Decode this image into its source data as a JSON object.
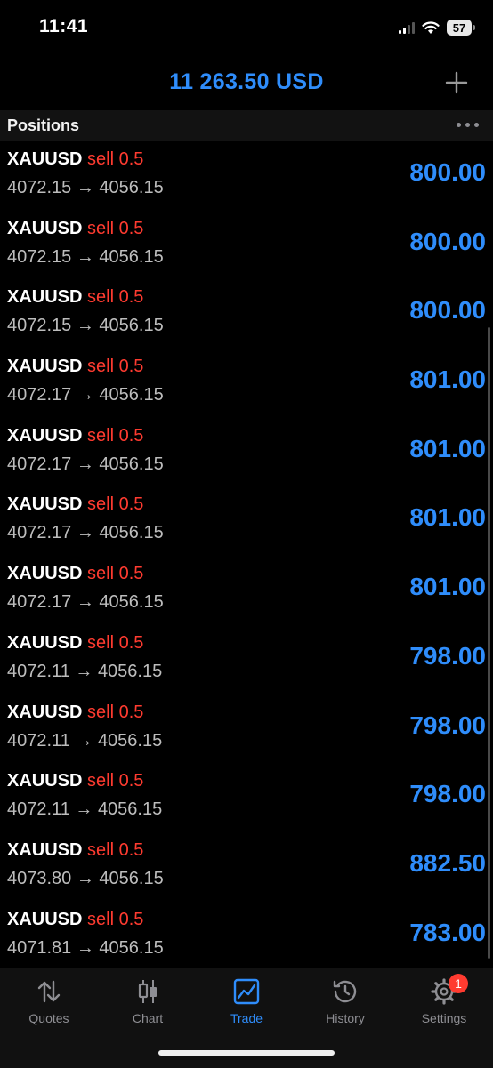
{
  "status_bar": {
    "time": "11:41",
    "battery": "57"
  },
  "header": {
    "balance": "11 263.50 USD",
    "add_icon": "plus-icon"
  },
  "section": {
    "title": "Positions",
    "more_icon": "more-horizontal-icon"
  },
  "positions": [
    {
      "symbol": "XAUUSD",
      "side": "sell",
      "volume": "0.5",
      "open": "4072.15",
      "arrow": "→",
      "current": "4056.15",
      "profit": "800.00"
    },
    {
      "symbol": "XAUUSD",
      "side": "sell",
      "volume": "0.5",
      "open": "4072.15",
      "arrow": "→",
      "current": "4056.15",
      "profit": "800.00"
    },
    {
      "symbol": "XAUUSD",
      "side": "sell",
      "volume": "0.5",
      "open": "4072.15",
      "arrow": "→",
      "current": "4056.15",
      "profit": "800.00"
    },
    {
      "symbol": "XAUUSD",
      "side": "sell",
      "volume": "0.5",
      "open": "4072.17",
      "arrow": "→",
      "current": "4056.15",
      "profit": "801.00"
    },
    {
      "symbol": "XAUUSD",
      "side": "sell",
      "volume": "0.5",
      "open": "4072.17",
      "arrow": "→",
      "current": "4056.15",
      "profit": "801.00"
    },
    {
      "symbol": "XAUUSD",
      "side": "sell",
      "volume": "0.5",
      "open": "4072.17",
      "arrow": "→",
      "current": "4056.15",
      "profit": "801.00"
    },
    {
      "symbol": "XAUUSD",
      "side": "sell",
      "volume": "0.5",
      "open": "4072.17",
      "arrow": "→",
      "current": "4056.15",
      "profit": "801.00"
    },
    {
      "symbol": "XAUUSD",
      "side": "sell",
      "volume": "0.5",
      "open": "4072.11",
      "arrow": "→",
      "current": "4056.15",
      "profit": "798.00"
    },
    {
      "symbol": "XAUUSD",
      "side": "sell",
      "volume": "0.5",
      "open": "4072.11",
      "arrow": "→",
      "current": "4056.15",
      "profit": "798.00"
    },
    {
      "symbol": "XAUUSD",
      "side": "sell",
      "volume": "0.5",
      "open": "4072.11",
      "arrow": "→",
      "current": "4056.15",
      "profit": "798.00"
    },
    {
      "symbol": "XAUUSD",
      "side": "sell",
      "volume": "0.5",
      "open": "4073.80",
      "arrow": "→",
      "current": "4056.15",
      "profit": "882.50"
    },
    {
      "symbol": "XAUUSD",
      "side": "sell",
      "volume": "0.5",
      "open": "4071.81",
      "arrow": "→",
      "current": "4056.15",
      "profit": "783.00"
    }
  ],
  "tabs": [
    {
      "label": "Quotes",
      "icon": "up-down-arrows-icon",
      "active": false
    },
    {
      "label": "Chart",
      "icon": "candlestick-icon",
      "active": false
    },
    {
      "label": "Trade",
      "icon": "trade-chart-icon",
      "active": true
    },
    {
      "label": "History",
      "icon": "history-clock-icon",
      "active": false
    },
    {
      "label": "Settings",
      "icon": "gear-icon",
      "active": false,
      "badge": "1"
    }
  ],
  "colors": {
    "accent": "#2f8dfb",
    "sell": "#ff3b30",
    "background": "#000000"
  }
}
